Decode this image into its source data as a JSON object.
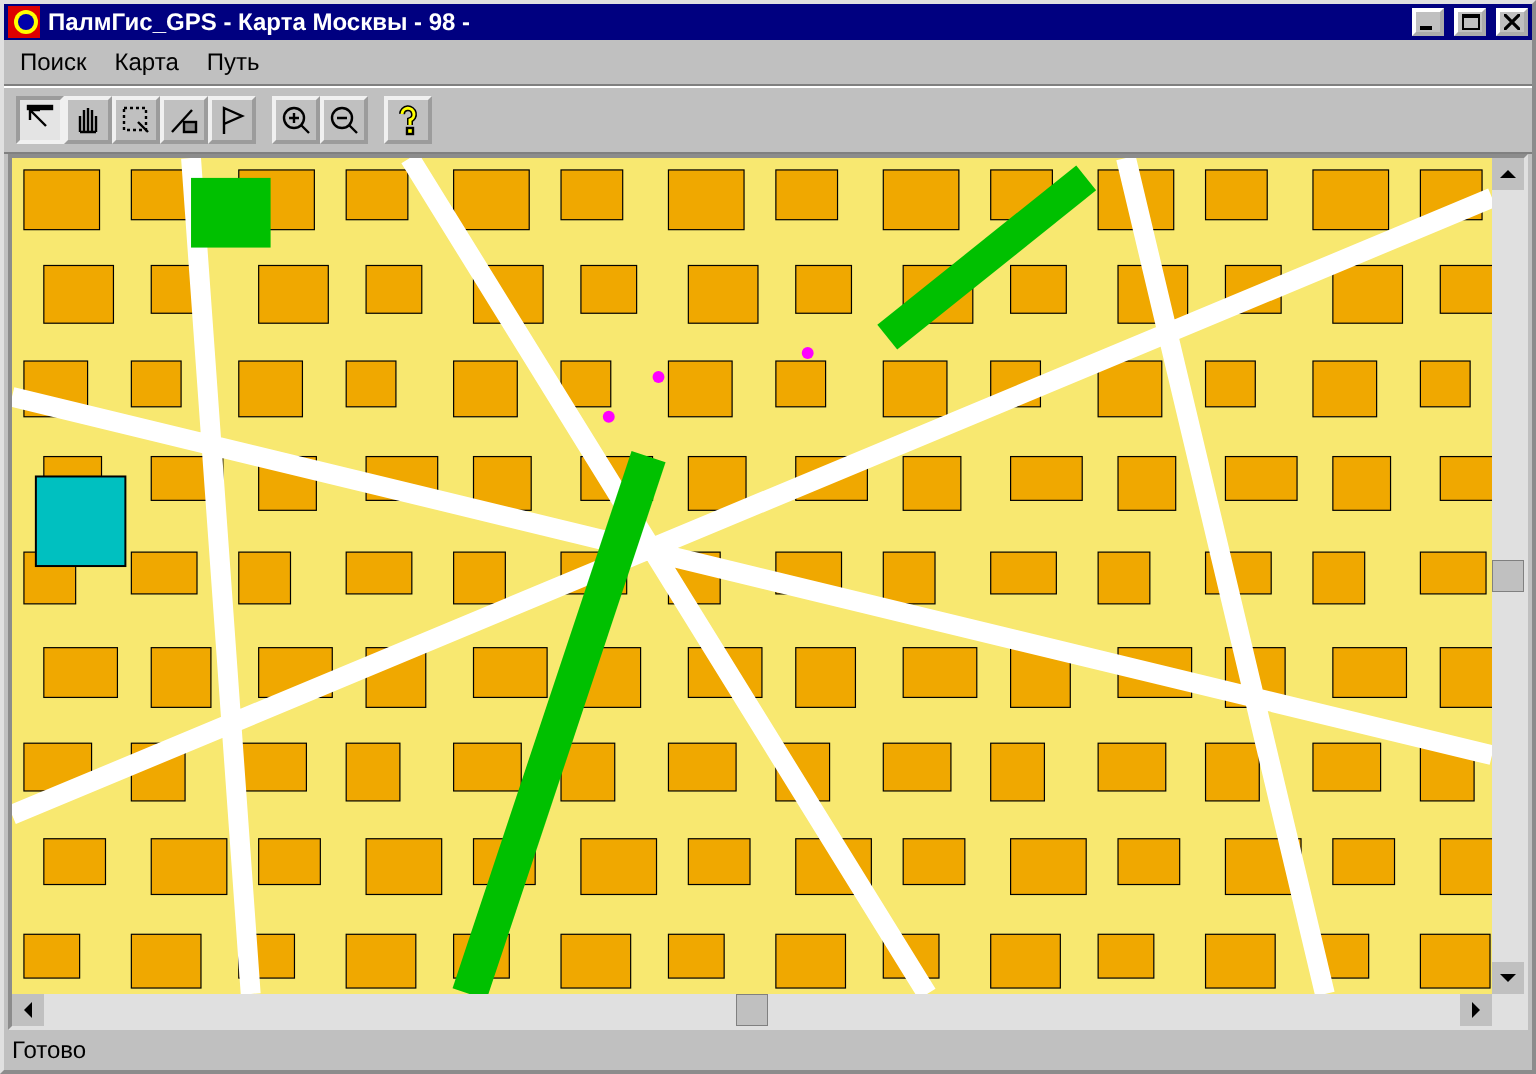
{
  "window": {
    "title": "ПалмГис_GPS - Карта Москвы - 98 -"
  },
  "menu": [
    {
      "label": "Поиск"
    },
    {
      "label": "Карта"
    },
    {
      "label": "Путь"
    }
  ],
  "toolbar": {
    "groups": [
      [
        {
          "kind": "pointer",
          "selected": true
        },
        {
          "kind": "hand",
          "selected": false
        },
        {
          "kind": "select",
          "selected": false
        },
        {
          "kind": "draw",
          "selected": false
        },
        {
          "kind": "flag",
          "selected": false
        }
      ],
      [
        {
          "kind": "zoom_in",
          "selected": false
        },
        {
          "kind": "zoom_out",
          "selected": false
        }
      ],
      [
        {
          "kind": "help",
          "selected": false
        }
      ]
    ]
  },
  "status_bar": {
    "text": "Готово"
  }
}
